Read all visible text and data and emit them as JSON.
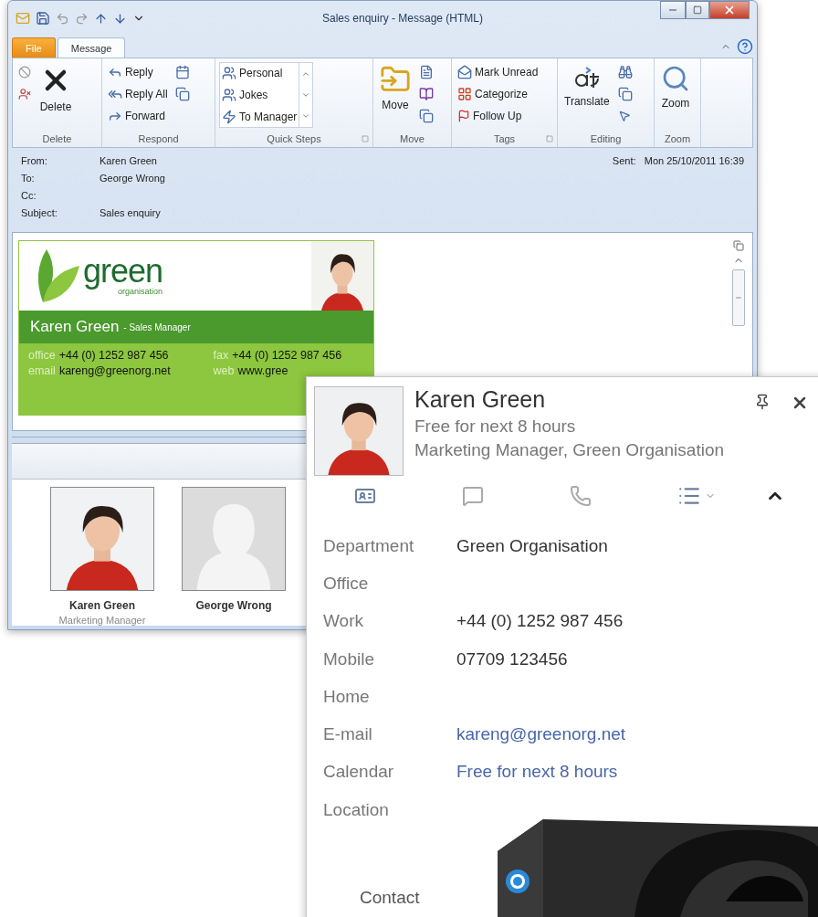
{
  "window": {
    "title": "Sales enquiry - Message (HTML)"
  },
  "ribbon_tabs": [
    {
      "label": "File",
      "selected": false,
      "kind": "file"
    },
    {
      "label": "Message",
      "selected": true,
      "kind": "tab"
    }
  ],
  "ribbon_groups": [
    {
      "label": "Delete",
      "items": [
        {
          "label": "Delete",
          "kind": "large"
        }
      ]
    },
    {
      "label": "Respond",
      "items": [
        {
          "label": "Reply",
          "kind": "small"
        },
        {
          "label": "Reply All",
          "kind": "small"
        },
        {
          "label": "Forward",
          "kind": "small"
        }
      ]
    },
    {
      "label": "Quick Steps",
      "launcher": true,
      "items": [
        {
          "label": "Personal",
          "kind": "gallery"
        },
        {
          "label": "Jokes",
          "kind": "gallery"
        },
        {
          "label": "To Manager",
          "kind": "gallery"
        }
      ]
    },
    {
      "label": "Move",
      "items": [
        {
          "label": "Move",
          "kind": "large"
        }
      ]
    },
    {
      "label": "Tags",
      "launcher": true,
      "items": [
        {
          "label": "Mark Unread",
          "kind": "small"
        },
        {
          "label": "Categorize",
          "kind": "small"
        },
        {
          "label": "Follow Up",
          "kind": "small"
        }
      ]
    },
    {
      "label": "Editing",
      "items": [
        {
          "label": "Translate",
          "kind": "large"
        }
      ]
    },
    {
      "label": "Zoom",
      "items": [
        {
          "label": "Zoom",
          "kind": "large"
        }
      ]
    }
  ],
  "header": {
    "fields": [
      {
        "label": "From:",
        "value": "Karen Green"
      },
      {
        "label": "To:",
        "value": "George Wrong"
      },
      {
        "label": "Cc:"
      },
      {
        "label": "Subject:",
        "value": "Sales enquiry"
      }
    ],
    "sent": {
      "label": "Sent:",
      "value": "Mon 25/10/2011 16:39"
    }
  },
  "signature": {
    "logo_word": "green",
    "logo_sub": "organisation",
    "name": "Karen Green",
    "role": "- Sales Manager",
    "contacts": [
      {
        "label": "office",
        "value": "+44 (0) 1252 987 456"
      },
      {
        "label": "fax",
        "value": "+44 (0) 1252 987 456"
      },
      {
        "label": "email",
        "value": "kareng@greenorg.net"
      },
      {
        "label": "web",
        "value": "www.gree"
      }
    ]
  },
  "people": [
    {
      "name": "Karen Green",
      "title": "Marketing Manager"
    },
    {
      "name": "George Wrong",
      "kind": "placeholder"
    }
  ],
  "contact_card": {
    "name": "Karen Green",
    "status": "Free for next 8 hours",
    "title": "Marketing Manager, Green Organisation",
    "fields": [
      {
        "label": "Department",
        "value": "Green Organisation",
        "kind": "text"
      },
      {
        "label": "Office",
        "kind": "text"
      },
      {
        "label": "Work",
        "value": "+44 (0) 1252 987 456",
        "kind": "text"
      },
      {
        "label": "Mobile",
        "value": "07709 123456",
        "kind": "text"
      },
      {
        "label": "Home",
        "kind": "text"
      },
      {
        "label": "E-mail",
        "value": "kareng@greenorg.net",
        "kind": "link"
      },
      {
        "label": "Calendar",
        "value": "Free for next 8 hours",
        "kind": "link"
      },
      {
        "label": "Location",
        "kind": "text"
      }
    ],
    "footer_tab": "Contact"
  }
}
